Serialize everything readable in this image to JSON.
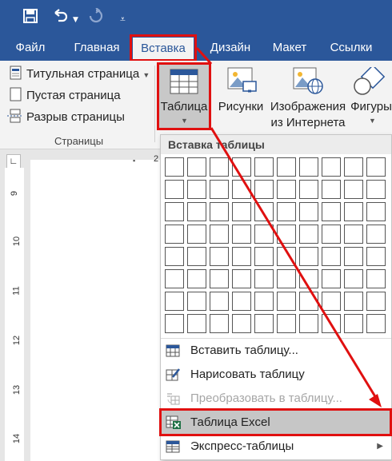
{
  "quick_access": {
    "save_icon": "save-icon",
    "undo_icon": "undo-icon",
    "redo_icon": "redo-icon"
  },
  "tabs": [
    {
      "label": "Файл"
    },
    {
      "label": "Главная"
    },
    {
      "label": "Вставка",
      "active": true
    },
    {
      "label": "Дизайн"
    },
    {
      "label": "Макет"
    },
    {
      "label": "Ссылки"
    }
  ],
  "pages_group": {
    "title_page": "Титульная страница",
    "blank_page": "Пустая страница",
    "page_break": "Разрыв страницы",
    "group_label": "Страницы"
  },
  "ribbon_buttons": {
    "table": "Таблица",
    "pictures": "Рисунки",
    "online_pictures_line1": "Изображения",
    "online_pictures_line2": "из Интернета",
    "shapes": "Фигуры"
  },
  "ruler": {
    "top_tick": "2",
    "marks": [
      "9",
      "10",
      "11",
      "12",
      "13",
      "14"
    ]
  },
  "insert_table_menu": {
    "header": "Вставка таблицы",
    "grid_cols": 10,
    "grid_rows": 8,
    "items": [
      {
        "label": "Вставить таблицу...",
        "icon": "insert-table-icon"
      },
      {
        "label": "Нарисовать таблицу",
        "icon": "draw-table-icon"
      },
      {
        "label": "Преобразовать в таблицу...",
        "icon": "convert-to-table-icon",
        "disabled": true
      },
      {
        "label": "Таблица Excel",
        "icon": "excel-table-icon",
        "highlighted": true
      },
      {
        "label": "Экспресс-таблицы",
        "icon": "quick-tables-icon",
        "submenu": true
      }
    ]
  },
  "colors": {
    "accent": "#2b579a",
    "highlight_border": "#e01010"
  }
}
